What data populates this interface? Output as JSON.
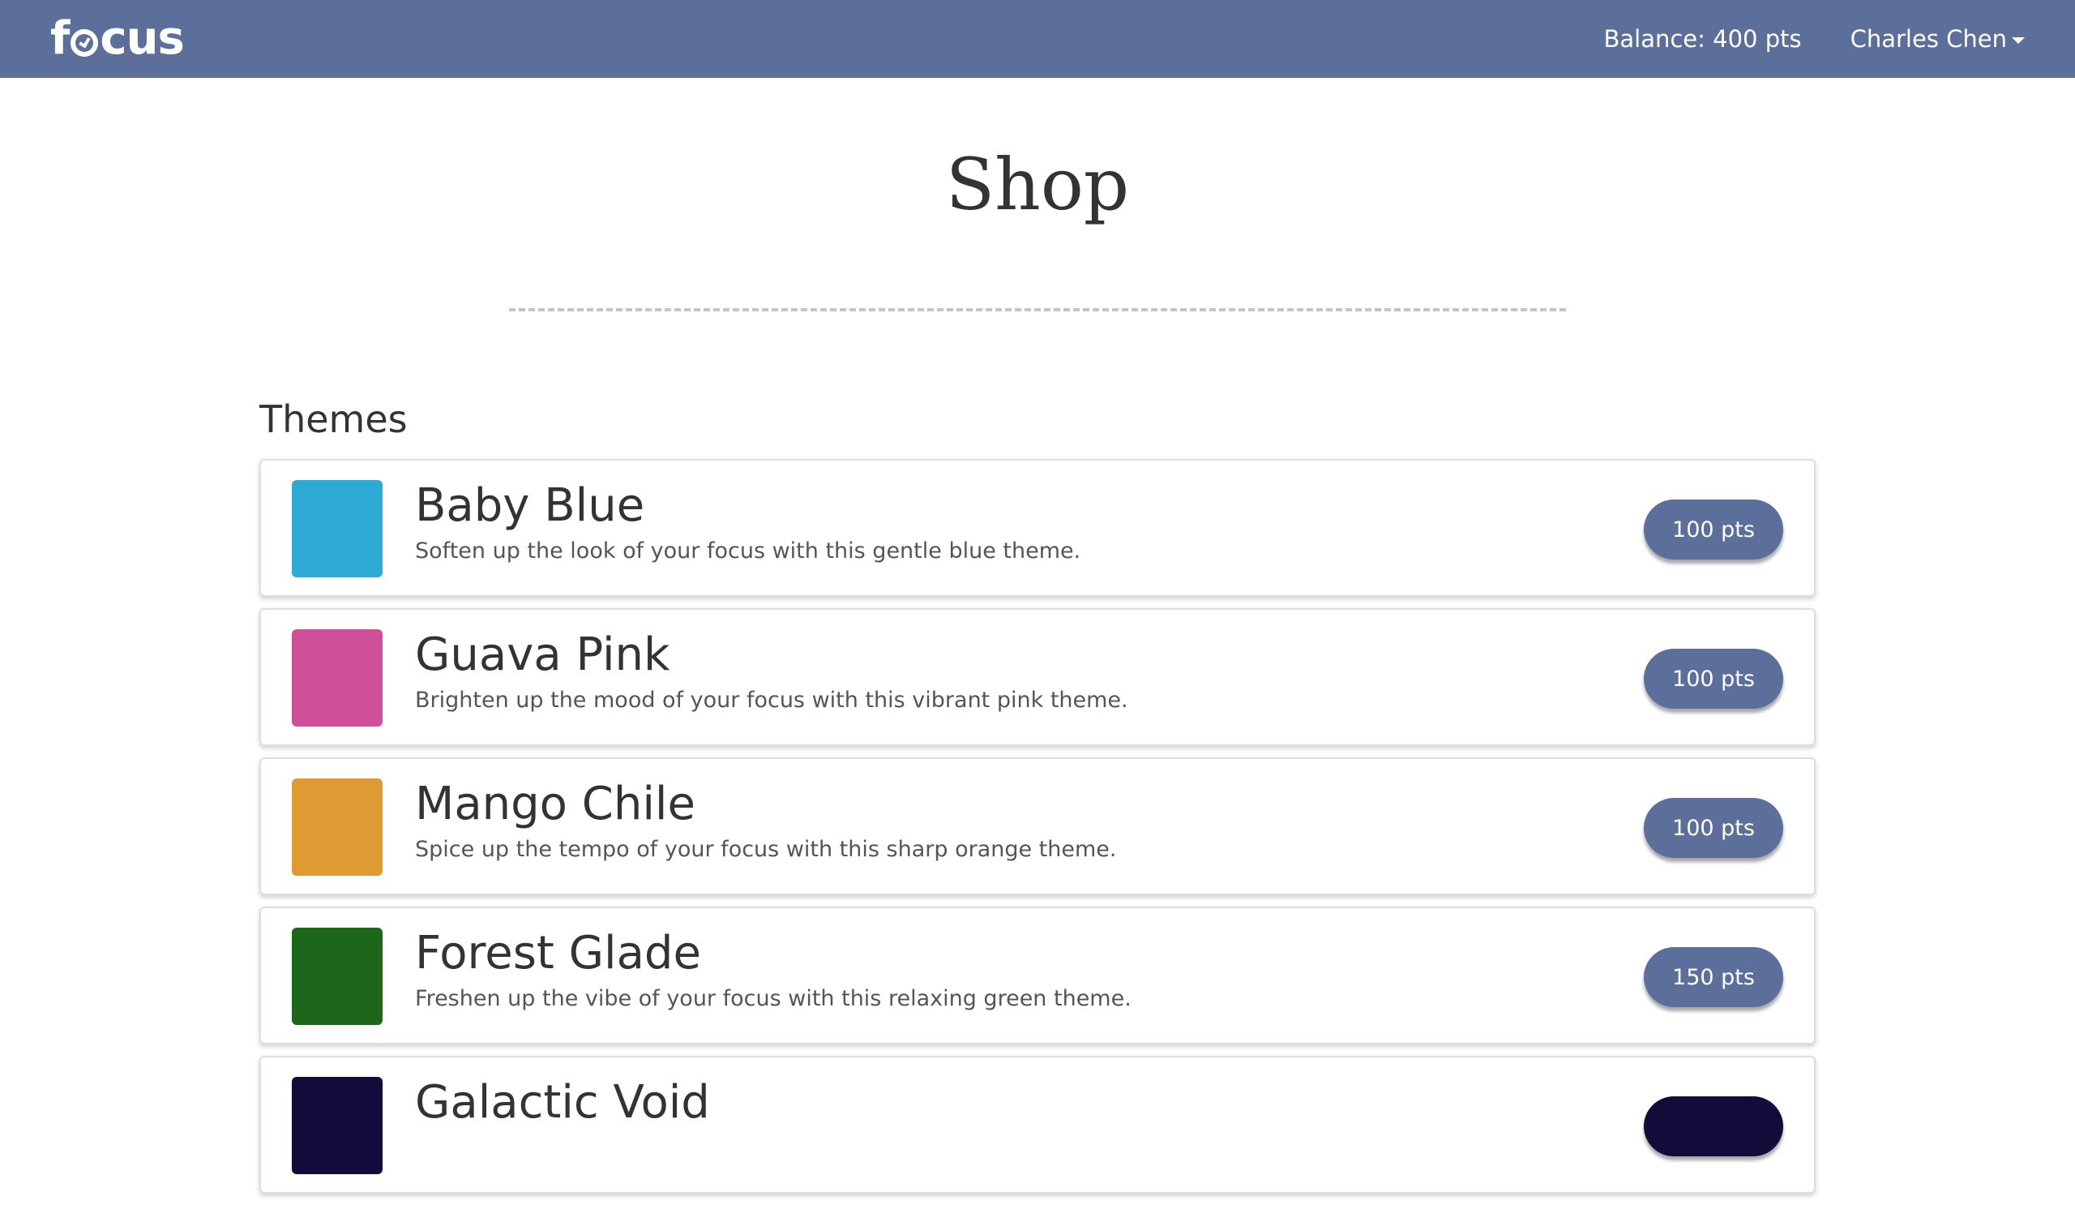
{
  "navbar": {
    "logo_text_left": "f",
    "logo_text_right": "cus",
    "balance": "Balance: 400 pts",
    "user_name": "Charles Chen",
    "background_color": "#5c6f9a"
  },
  "page": {
    "title": "Shop"
  },
  "themes_section": {
    "heading": "Themes",
    "items": [
      {
        "name": "Baby Blue",
        "description": "Soften up the look of your focus with this gentle blue theme.",
        "price": "100 pts",
        "swatch_color": "#2eabd4",
        "button_color": "#5c6f9a"
      },
      {
        "name": "Guava Pink",
        "description": "Brighten up the mood of your focus with this vibrant pink theme.",
        "price": "100 pts",
        "swatch_color": "#cf4f98",
        "button_color": "#5c6f9a"
      },
      {
        "name": "Mango Chile",
        "description": "Spice up the tempo of your focus with this sharp orange theme.",
        "price": "100 pts",
        "swatch_color": "#de9a33",
        "button_color": "#5c6f9a"
      },
      {
        "name": "Forest Glade",
        "description": "Freshen up the vibe of your focus with this relaxing green theme.",
        "price": "150 pts",
        "swatch_color": "#1d661a",
        "button_color": "#5c6f9a"
      },
      {
        "name": "Galactic Void",
        "description": "",
        "price": "",
        "swatch_color": "#120c3a",
        "button_color": "#120c3a"
      }
    ]
  }
}
